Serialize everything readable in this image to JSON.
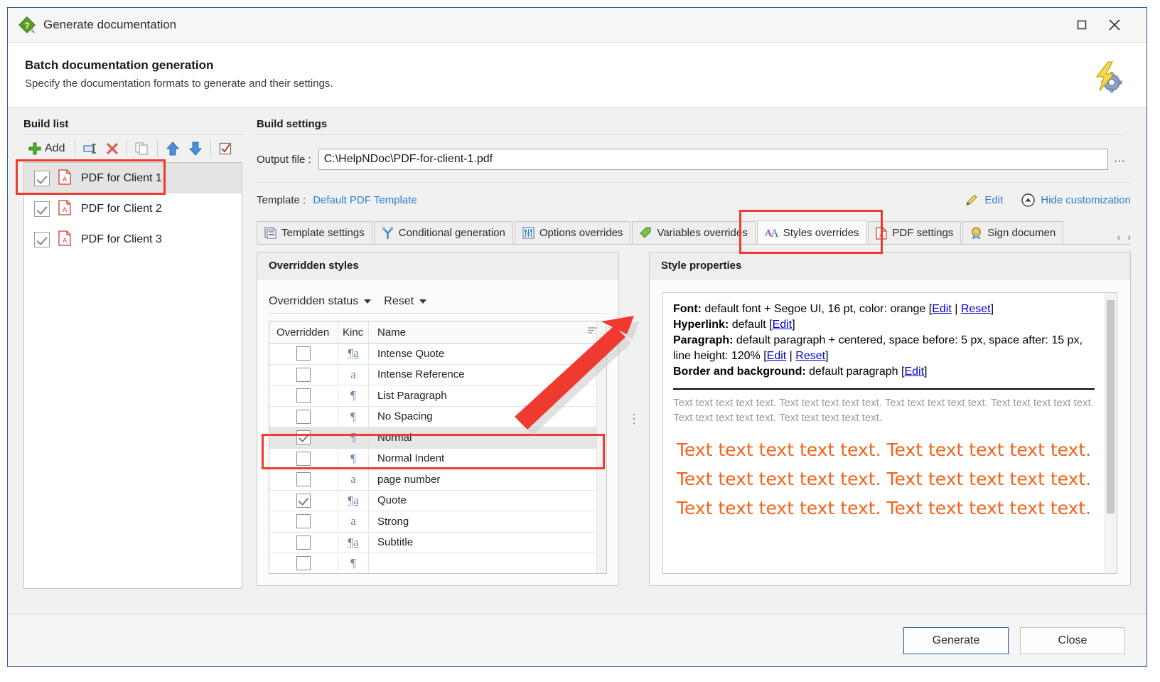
{
  "window": {
    "title": "Generate documentation",
    "controls": {
      "maximize": "▢",
      "close": "✕"
    }
  },
  "header": {
    "heading": "Batch documentation generation",
    "subheading": "Specify the documentation formats to generate and their settings."
  },
  "build_list": {
    "label": "Build list",
    "toolbar": {
      "add_label": "Add",
      "buttons": [
        "add",
        "rename",
        "delete",
        "duplicate",
        "move-up",
        "move-down",
        "toggle-all"
      ]
    },
    "items": [
      {
        "label": "PDF for Client 1",
        "checked": true,
        "selected": true
      },
      {
        "label": "PDF for Client 2",
        "checked": true,
        "selected": false
      },
      {
        "label": "PDF for Client 3",
        "checked": true,
        "selected": false
      }
    ]
  },
  "build_settings": {
    "label": "Build settings",
    "output_file": {
      "label": "Output file :",
      "value": "C:\\HelpNDoc\\PDF-for-client-1.pdf",
      "browse": "···"
    },
    "template": {
      "label": "Template :",
      "value": "Default PDF Template"
    },
    "edit_link": "Edit",
    "hide_customization_link": "Hide customization"
  },
  "tabs": {
    "items": [
      {
        "label": "Template settings",
        "icon": "template-settings-icon",
        "active": false
      },
      {
        "label": "Conditional generation",
        "icon": "conditional-generation-icon",
        "active": false
      },
      {
        "label": "Options overrides",
        "icon": "options-overrides-icon",
        "active": false
      },
      {
        "label": "Variables overrides",
        "icon": "variables-overrides-icon",
        "active": false
      },
      {
        "label": "Styles overrides",
        "icon": "styles-overrides-icon",
        "active": true
      },
      {
        "label": "PDF settings",
        "icon": "pdf-settings-icon",
        "active": false
      },
      {
        "label": "Sign documen",
        "icon": "sign-document-icon",
        "active": false
      }
    ],
    "nav_prev": "‹",
    "nav_next": "›"
  },
  "overridden_styles": {
    "title": "Overridden styles",
    "filters": {
      "status": "Overridden status",
      "reset": "Reset"
    },
    "columns": [
      "Overridden",
      "Kinc",
      "Name"
    ],
    "rows": [
      {
        "overridden": false,
        "kind": "paragraph-character",
        "name": "Intense Quote"
      },
      {
        "overridden": false,
        "kind": "character",
        "name": "Intense Reference"
      },
      {
        "overridden": false,
        "kind": "paragraph",
        "name": "List Paragraph"
      },
      {
        "overridden": false,
        "kind": "paragraph",
        "name": "No Spacing"
      },
      {
        "overridden": true,
        "kind": "paragraph",
        "name": "Normal",
        "selected": true
      },
      {
        "overridden": false,
        "kind": "paragraph",
        "name": "Normal Indent"
      },
      {
        "overridden": false,
        "kind": "character",
        "name": "page number"
      },
      {
        "overridden": true,
        "kind": "paragraph-character",
        "name": "Quote"
      },
      {
        "overridden": false,
        "kind": "character",
        "name": "Strong"
      },
      {
        "overridden": false,
        "kind": "paragraph-character",
        "name": "Subtitle"
      }
    ]
  },
  "style_properties": {
    "title": "Style properties",
    "lines": [
      {
        "label": "Font:",
        "text": " default font + Segoe UI, 16 pt, color: orange [",
        "links": [
          "Edit",
          "Reset"
        ],
        "sep": " | ",
        "end": "]"
      },
      {
        "label": "Hyperlink:",
        "text": " default [",
        "links": [
          "Edit"
        ],
        "sep": "",
        "end": "]"
      },
      {
        "label": "Paragraph:",
        "text": " default paragraph + centered, space before: 5 px, space after: 15 px, line height: 120% [",
        "links": [
          "Edit",
          "Reset"
        ],
        "sep": " | ",
        "end": "]"
      },
      {
        "label": "Border and background:",
        "text": "  default paragraph [",
        "links": [
          "Edit"
        ],
        "sep": "",
        "end": "]"
      }
    ],
    "preview_gray": "Text text text text text. Text text text text text. Text text text text text. Text text text text text. Text text text text text. Text text text text text.",
    "preview_orange": "Text text text text text. Text text text text text. Text text text text text. Text text text text text. Text text text text text. Text text text text text.",
    "orange_color": "#F2641A"
  },
  "footer": {
    "generate": "Generate",
    "close": "Close"
  }
}
